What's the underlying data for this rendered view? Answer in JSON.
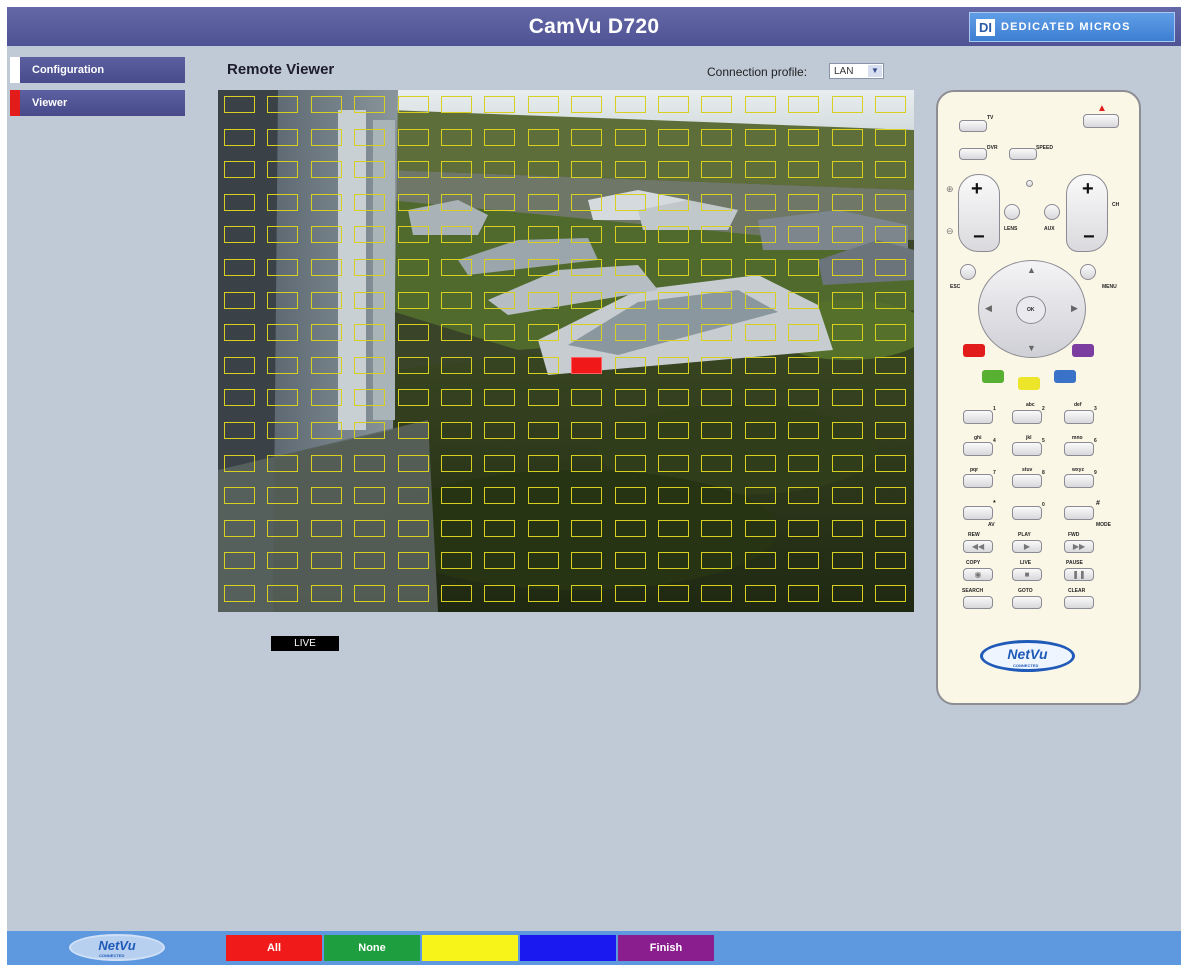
{
  "header": {
    "title": "CamVu D720",
    "brand_mark": "DI",
    "brand_text": "DEDICATED MICROS"
  },
  "sidebar": {
    "items": [
      {
        "label": "Configuration",
        "active": false
      },
      {
        "label": "Viewer",
        "active": true
      }
    ]
  },
  "viewer": {
    "title": "Remote Viewer",
    "profile_label": "Connection profile:",
    "profile_value": "LAN",
    "live_label": "LIVE",
    "grid": {
      "columns": 16,
      "rows": 16,
      "selected": [
        {
          "row": 8,
          "col": 8
        }
      ]
    }
  },
  "remote": {
    "labels": {
      "tv": "TV",
      "dvr": "DVR",
      "speed": "SPEED",
      "lens": "LENS",
      "aux": "AUX",
      "esc": "ESC",
      "menu": "MENU",
      "ok": "OK",
      "ch": "CH",
      "k1": "1",
      "k2": "2",
      "k3": "3",
      "k4": "4",
      "k5": "5",
      "k6": "6",
      "k7": "7",
      "k8": "8",
      "k9": "9",
      "k0": "0",
      "abc": "abc",
      "def": "def",
      "ghi": "ghi",
      "jkl": "jkl",
      "mno": "mno",
      "pqr": "pqr",
      "stuv": "stuv",
      "wxyz": "wxyz",
      "star": "*",
      "hash": "#",
      "av": "AV",
      "mode": "MODE",
      "rew": "REW",
      "play": "PLAY",
      "fwd": "FWD",
      "copy": "COPY",
      "live": "LIVE",
      "pause": "PAUSE",
      "search": "SEARCH",
      "goto": "GOTO",
      "clear": "CLEAR"
    },
    "logo_text": "NetVu",
    "logo_tag": "CONNECTED"
  },
  "footer": {
    "logo_text": "NetVu",
    "logo_tag": "CONNECTED",
    "buttons": {
      "all": "All",
      "none": "None",
      "yellow": "",
      "blue": "",
      "finish": "Finish"
    }
  },
  "colors": {
    "red": "#f01a1a",
    "green": "#1e9e3e",
    "yellow": "#f7f41a",
    "blue": "#1a1af0",
    "purple": "#8a1e8f",
    "grid": "#d8d020"
  }
}
